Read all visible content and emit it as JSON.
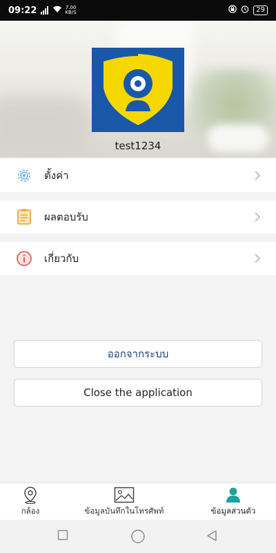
{
  "status_bar": {
    "time": "09:22",
    "speed_value": "7.00",
    "speed_unit": "KB/S",
    "battery": "29"
  },
  "profile": {
    "username": "test1234"
  },
  "menu": [
    {
      "label": "ตั้งค่า",
      "icon": "settings-gear-icon"
    },
    {
      "label": "ผลตอบรับ",
      "icon": "feedback-document-icon"
    },
    {
      "label": "เกี่ยวกับ",
      "icon": "info-icon"
    }
  ],
  "buttons": {
    "logout": "ออกจากระบบ",
    "close_app": "Close the application"
  },
  "tabs": [
    {
      "label": "กล้อง",
      "icon": "location-pin-icon",
      "active": false
    },
    {
      "label": "ข้อมูลบันทึกในโทรศัพท์",
      "icon": "image-icon",
      "active": false
    },
    {
      "label": "ข้อมูลส่วนตัว",
      "icon": "person-icon",
      "active": true
    }
  ],
  "colors": {
    "accent": "#1ba39c",
    "logo_blue": "#1958a9",
    "logo_yellow": "#f4d800",
    "logout_text": "#1c3f74"
  }
}
